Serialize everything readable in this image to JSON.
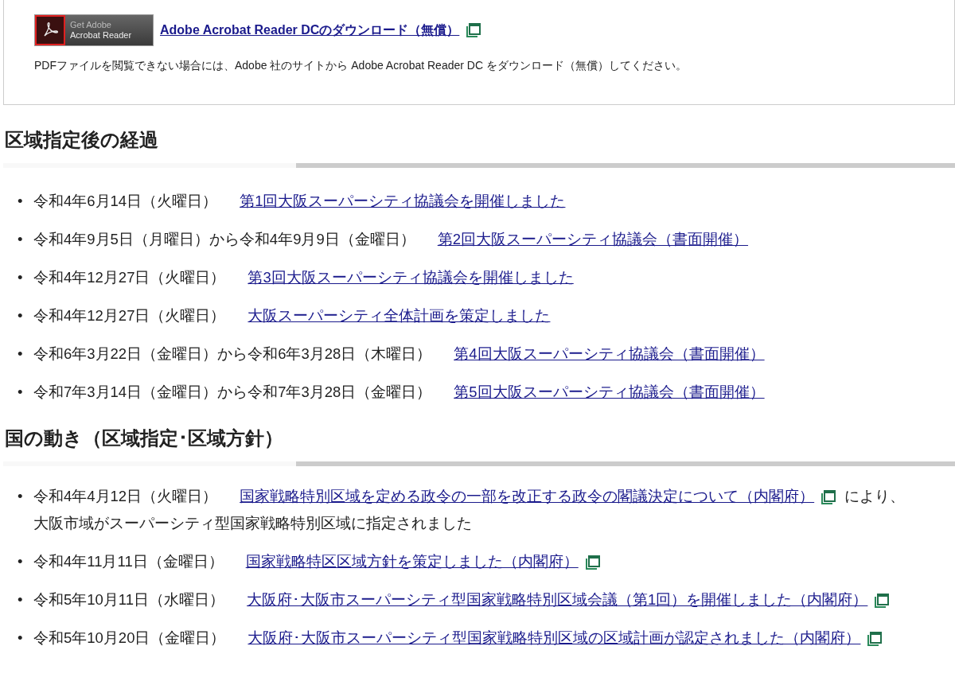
{
  "download_box": {
    "badge": {
      "line1": "Get Adobe",
      "line2": "Acrobat Reader"
    },
    "link": "Adobe Acrobat Reader DCのダウンロード（無償）",
    "external": true,
    "note": "PDFファイルを閲覧できない場合には、Adobe 社のサイトから Adobe Acrobat Reader DC をダウンロード（無償）してください。"
  },
  "sections": [
    {
      "heading": "区域指定後の経過",
      "items": [
        {
          "marker": "•",
          "date": "令和4年6月14日（火曜日）",
          "link": "第1回大阪スーパーシティ協議会を開催しました",
          "external": false
        },
        {
          "marker": "•",
          "date": "令和4年9月5日（月曜日）から令和4年9月9日（金曜日）",
          "link": "第2回大阪スーパーシティ協議会（書面開催）",
          "external": false
        },
        {
          "marker": "•",
          "date": "令和4年12月27日（火曜日）",
          "link": "第3回大阪スーパーシティ協議会を開催しました",
          "external": false
        },
        {
          "marker": "•",
          "date": "令和4年12月27日（火曜日）",
          "link": "大阪スーパーシティ全体計画を策定しました",
          "external": false
        },
        {
          "marker": "•",
          "date": "令和6年3月22日（金曜日）から令和6年3月28日（木曜日）",
          "link": "第4回大阪スーパーシティ協議会（書面開催）",
          "external": false
        },
        {
          "marker": "•",
          "date": "令和7年3月14日（金曜日）から令和7年3月28日（金曜日）",
          "link": "第5回大阪スーパーシティ協議会（書面開催）",
          "external": false
        }
      ]
    },
    {
      "heading": "国の動き（区域指定･区域方針）",
      "items": [
        {
          "marker": "•",
          "date": "令和4年4月12日（火曜日）",
          "link": "国家戦略特別区域を定める政令の一部を改正する政令の閣議決定について（内閣府）",
          "external": true,
          "suffix": "により、",
          "continuation": "大阪市域がスーパーシティ型国家戦略特別区域に指定されました"
        },
        {
          "marker": "•",
          "date": "令和4年11月11日（金曜日）",
          "link": "国家戦略特区区域方針を策定しました（内閣府）",
          "external": true
        },
        {
          "marker": "•",
          "date": "令和5年10月11日（水曜日）",
          "link": "大阪府･大阪市スーパーシティ型国家戦略特別区域会議（第1回）を開催しました（内閣府）",
          "external": true
        },
        {
          "marker": "•",
          "date": "令和5年10月20日（金曜日）",
          "link": "大阪府･大阪市スーパーシティ型国家戦略特別区域の区域計画が認定されました（内閣府）",
          "external": true
        }
      ]
    }
  ]
}
